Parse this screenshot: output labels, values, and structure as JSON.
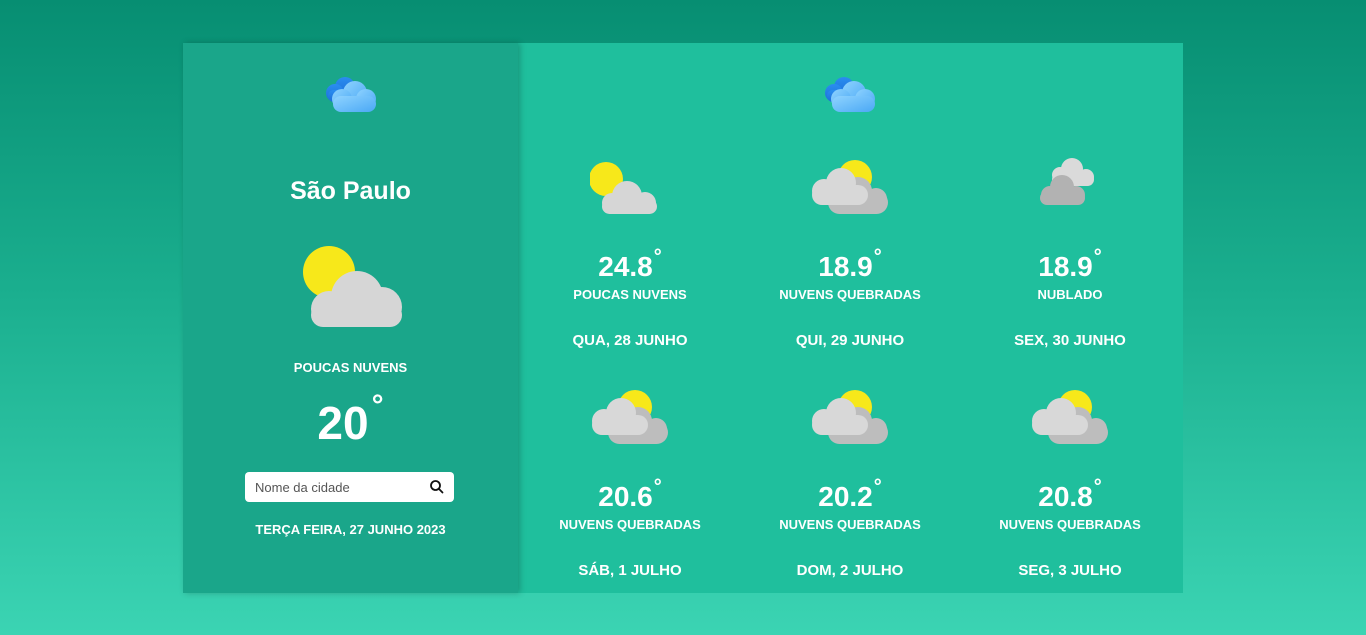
{
  "current": {
    "city": "São Paulo",
    "description": "POUCAS NUVENS",
    "temperature": "20",
    "degree_symbol": "°",
    "date": "TERÇA FEIRA, 27 JUNHO 2023",
    "icon": "sun-behind-cloud-icon"
  },
  "search": {
    "placeholder": "Nome da cidade",
    "value": "",
    "icon": "search-icon"
  },
  "logo_icon": "cloud-logo-icon",
  "forecast": [
    {
      "temp": "24.8",
      "description": "POUCAS NUVENS",
      "date": "QUA, 28 JUNHO",
      "icon": "sun-behind-cloud-icon"
    },
    {
      "temp": "18.9",
      "description": "NUVENS QUEBRADAS",
      "date": "QUI, 29 JUNHO",
      "icon": "broken-clouds-icon"
    },
    {
      "temp": "18.9",
      "description": "NUBLADO",
      "date": "SEX, 30 JUNHO",
      "icon": "overcast-clouds-icon"
    },
    {
      "temp": "20.6",
      "description": "NUVENS QUEBRADAS",
      "date": "SÁB, 1 JULHO",
      "icon": "broken-clouds-icon"
    },
    {
      "temp": "20.2",
      "description": "NUVENS QUEBRADAS",
      "date": "DOM, 2 JULHO",
      "icon": "broken-clouds-icon"
    },
    {
      "temp": "20.8",
      "description": "NUVENS QUEBRADAS",
      "date": "SEG, 3 JULHO",
      "icon": "broken-clouds-icon"
    }
  ],
  "colors": {
    "page_top": "#078e72",
    "page_bottom": "#3bd4b3",
    "left_panel": "#1aa68a",
    "right_panel": "#1fbf9d",
    "sun": "#f7e81a",
    "cloud_light": "#d9d9d9",
    "cloud_dark": "#b5b5b5",
    "logo_blue": "#2e8fef"
  }
}
